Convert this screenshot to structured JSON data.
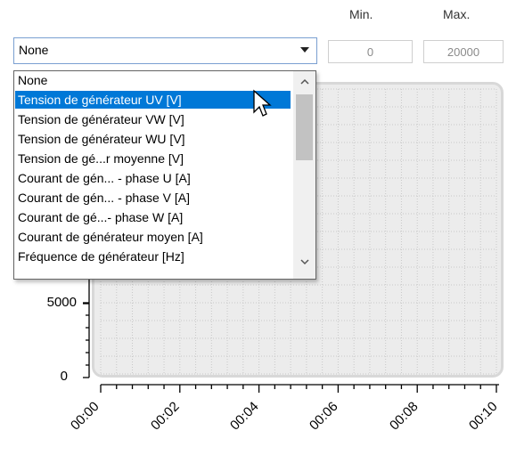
{
  "range": {
    "min_label": "Min.",
    "max_label": "Max.",
    "min_value": "0",
    "max_value": "20000"
  },
  "combo": {
    "selected": "None"
  },
  "dropdown": {
    "items": [
      "None",
      "Tension de générateur UV [V]",
      "Tension de générateur VW [V]",
      "Tension de générateur WU [V]",
      "Tension de gé...r moyenne [V]",
      "Courant de gén... - phase U [A]",
      "Courant de gén... - phase V [A]",
      "Courant de gé...- phase W [A]",
      "Courant de générateur moyen [A]",
      "Fréquence de générateur [Hz]"
    ],
    "highlighted_index": 1
  },
  "chart": {
    "y_ticks": [
      "5000",
      "0"
    ],
    "x_ticks": [
      "00:00",
      "00:02",
      "00:04",
      "00:06",
      "00:08",
      "00:10"
    ]
  },
  "colors": {
    "highlight": "#0078d7",
    "plot_bg": "#ececec"
  }
}
